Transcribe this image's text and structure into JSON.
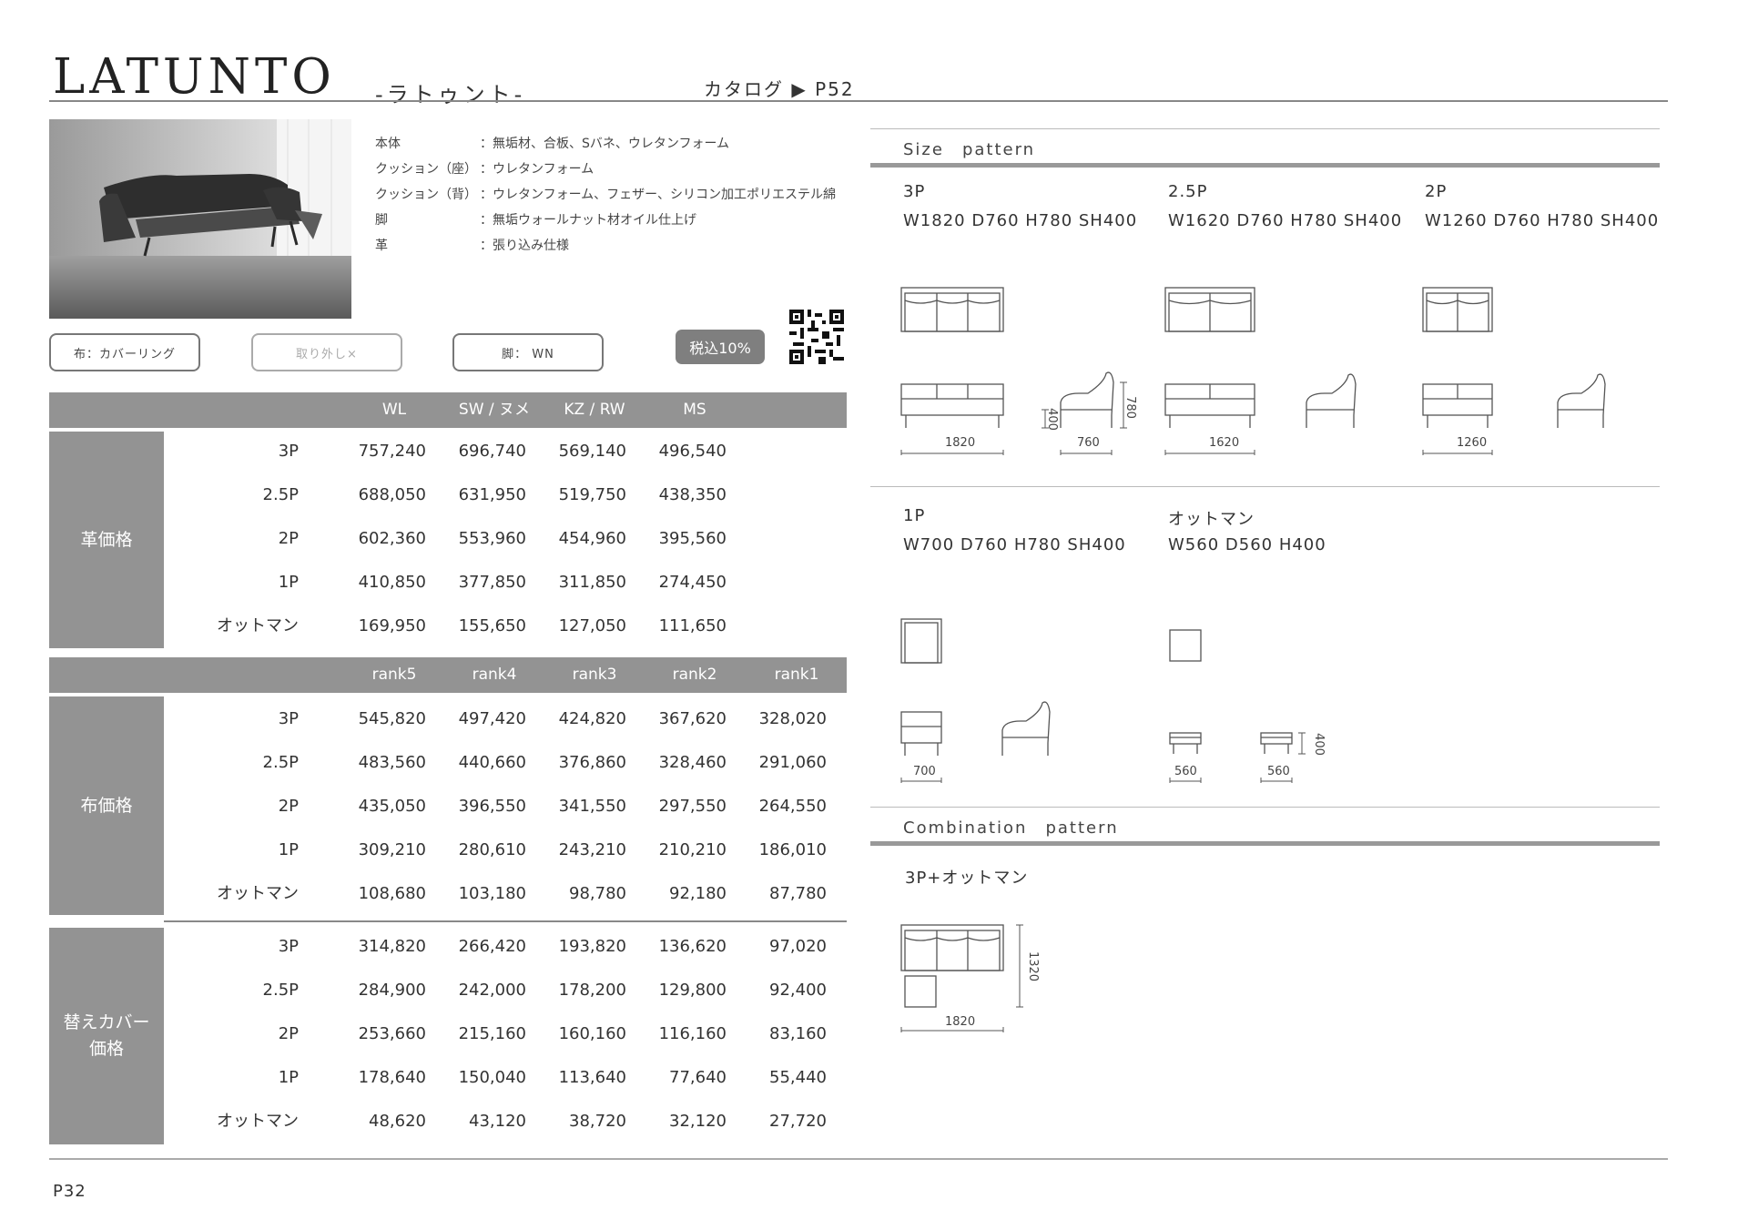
{
  "header": {
    "brand": "LATUNTO",
    "kana": "-ラトゥント-",
    "catalog_ref": "カタログ ▶ P52"
  },
  "specs": [
    {
      "label": "本体",
      "value": "：無垢材、合板、Sバネ、ウレタンフォーム"
    },
    {
      "label": "クッション（座）",
      "value": "：ウレタンフォーム"
    },
    {
      "label": "クッション（背）",
      "value": "：ウレタンフォーム、フェザー、シリコン加工ポリエステル綿"
    },
    {
      "label": "脚",
      "value": "：無垢ウォールナット材オイル仕上げ"
    },
    {
      "label": "革",
      "value": "：張り込み仕様"
    }
  ],
  "tags": {
    "cover": "布：カバーリング",
    "removable": "取り外し×",
    "legs": "脚： WN",
    "tax": "税込10%"
  },
  "leather_table": {
    "side_label": "革価格",
    "headers": [
      "WL",
      "SW / ヌメ",
      "KZ / RW",
      "MS"
    ],
    "rows": [
      {
        "name": "3P",
        "values": [
          "757,240",
          "696,740",
          "569,140",
          "496,540"
        ]
      },
      {
        "name": "2.5P",
        "values": [
          "688,050",
          "631,950",
          "519,750",
          "438,350"
        ]
      },
      {
        "name": "2P",
        "values": [
          "602,360",
          "553,960",
          "454,960",
          "395,560"
        ]
      },
      {
        "name": "1P",
        "values": [
          "410,850",
          "377,850",
          "311,850",
          "274,450"
        ]
      },
      {
        "name": "オットマン",
        "values": [
          "169,950",
          "155,650",
          "127,050",
          "111,650"
        ]
      }
    ]
  },
  "fabric_headers": [
    "rank5",
    "rank4",
    "rank3",
    "rank2",
    "rank1"
  ],
  "fabric_table": {
    "side_label": "布価格",
    "rows": [
      {
        "name": "3P",
        "values": [
          "545,820",
          "497,420",
          "424,820",
          "367,620",
          "328,020"
        ]
      },
      {
        "name": "2.5P",
        "values": [
          "483,560",
          "440,660",
          "376,860",
          "328,460",
          "291,060"
        ]
      },
      {
        "name": "2P",
        "values": [
          "435,050",
          "396,550",
          "341,550",
          "297,550",
          "264,550"
        ]
      },
      {
        "name": "1P",
        "values": [
          "309,210",
          "280,610",
          "243,210",
          "210,210",
          "186,010"
        ]
      },
      {
        "name": "オットマン",
        "values": [
          "108,680",
          "103,180",
          "98,780",
          "92,180",
          "87,780"
        ]
      }
    ]
  },
  "cover_table": {
    "side_label_1": "替えカバー",
    "side_label_2": "価格",
    "rows": [
      {
        "name": "3P",
        "values": [
          "314,820",
          "266,420",
          "193,820",
          "136,620",
          "97,020"
        ]
      },
      {
        "name": "2.5P",
        "values": [
          "284,900",
          "242,000",
          "178,200",
          "129,800",
          "92,400"
        ]
      },
      {
        "name": "2P",
        "values": [
          "253,660",
          "215,160",
          "160,160",
          "116,160",
          "83,160"
        ]
      },
      {
        "name": "1P",
        "values": [
          "178,640",
          "150,040",
          "113,640",
          "77,640",
          "55,440"
        ]
      },
      {
        "name": "オットマン",
        "values": [
          "48,620",
          "43,120",
          "38,720",
          "32,120",
          "27,720"
        ]
      }
    ]
  },
  "size_pattern": {
    "heading": "Size　pattern",
    "items": [
      {
        "name": "3P",
        "dims": "W1820 D760 H780 SH400"
      },
      {
        "name": "2.5P",
        "dims": "W1620 D760 H780 SH400"
      },
      {
        "name": "2P",
        "dims": "W1260 D760 H780 SH400"
      },
      {
        "name": "1P",
        "dims": "W700 D760 H780 SH400"
      },
      {
        "name": "オットマン",
        "dims": "W560 D560 H400"
      }
    ],
    "dim_labels": {
      "w3p": "1820",
      "d": "760",
      "sh": "400",
      "h": "780",
      "w25p": "1620",
      "w2p": "1260",
      "w1p": "700",
      "wott": "560",
      "dott": "560",
      "hott": "400"
    }
  },
  "combination_pattern": {
    "heading": "Combination　pattern",
    "name": "3P+オットマン",
    "dim_w": "1820",
    "dim_d": "1320"
  },
  "footer": {
    "page": "P32"
  },
  "colors": {
    "bar": "#939393",
    "line": "#888888",
    "tax_pill": "#7f7f7f"
  }
}
